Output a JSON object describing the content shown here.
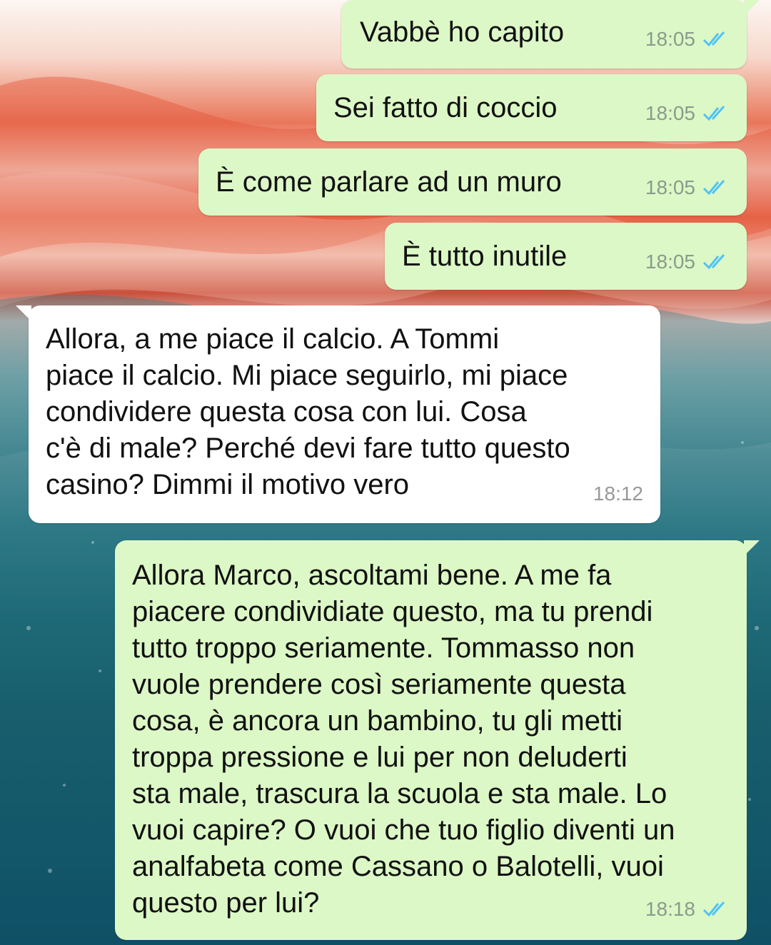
{
  "colors": {
    "outgoing_bubble": "#dcf8c6",
    "incoming_bubble": "#ffffff",
    "read_tick": "#4fc3f7"
  },
  "messages": [
    {
      "direction": "out",
      "text": "Vabbè ho capito",
      "time": "18:05",
      "status": "read-ticks-icon"
    },
    {
      "direction": "out",
      "text": "Sei fatto di coccio",
      "time": "18:05",
      "status": "read-ticks-icon"
    },
    {
      "direction": "out",
      "text": "È come parlare ad un muro",
      "time": "18:05",
      "status": "read-ticks-icon"
    },
    {
      "direction": "out",
      "text": "È tutto inutile",
      "time": "18:05",
      "status": "read-ticks-icon"
    },
    {
      "direction": "in",
      "text": "Allora, a me piace il calcio. A Tommi\npiace il calcio. Mi piace seguirlo, mi piace\ncondividere questa cosa con lui. Cosa\nc'è di male? Perché devi fare tutto questo\ncasino? Dimmi il motivo vero",
      "time": "18:12"
    },
    {
      "direction": "out",
      "text": "Allora Marco, ascoltami bene. A me fa\npiacere condividiate questo, ma tu prendi\ntutto troppo seriamente. Tommasso non\nvuole prendere così seriamente questa\ncosa, è ancora un bambino, tu gli metti\ntroppa pressione e lui per non deluderti\nsta male, trascura la scuola e sta male. Lo\nvuoi capire? O vuoi che tuo figlio diventi un\nanalfabeta come Cassano o Balotelli, vuoi\nquesto per lui?",
      "time": "18:18",
      "status": "read-ticks-icon"
    }
  ]
}
